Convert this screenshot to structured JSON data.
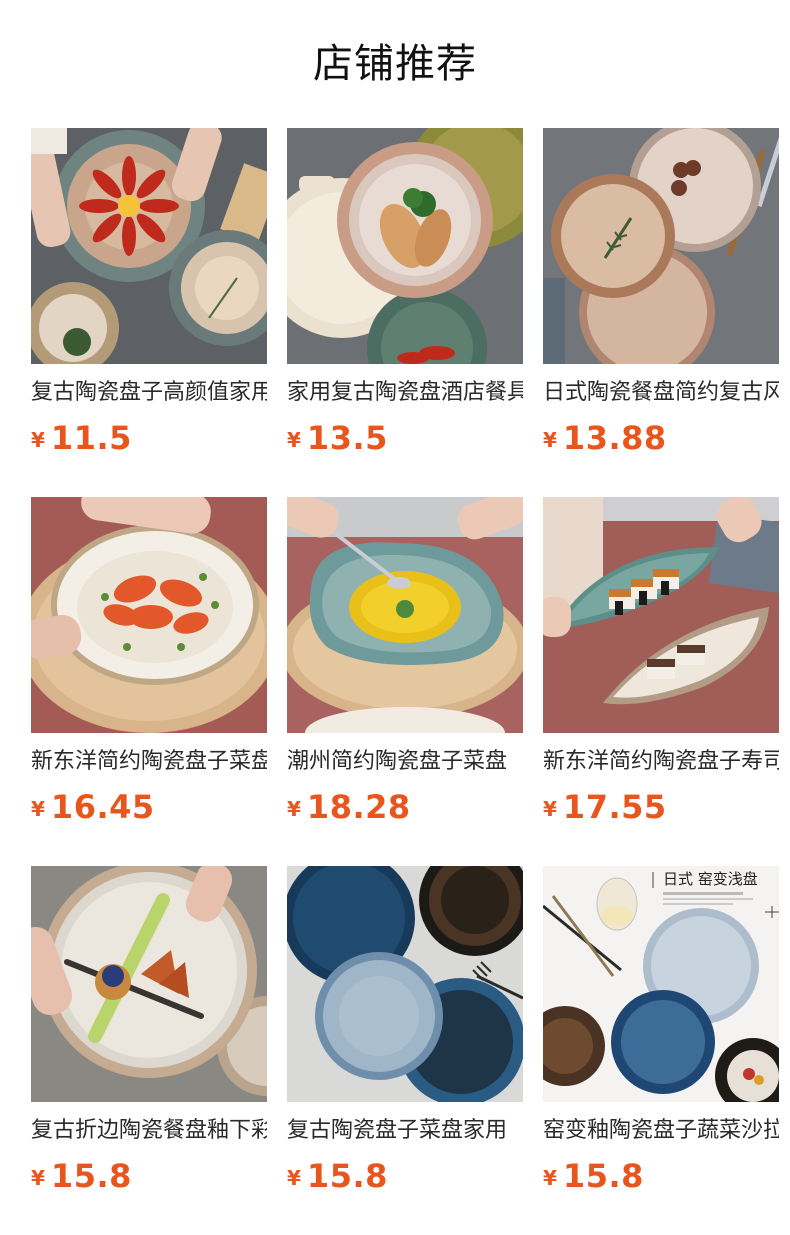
{
  "page": {
    "title": "店铺推荐"
  },
  "currency_symbol": "¥",
  "accent_color": "#e8561e",
  "products": [
    {
      "name": "复古陶瓷盘子高颜值家用",
      "price": "11.5"
    },
    {
      "name": "家用复古陶瓷盘酒店餐具",
      "price": "13.5"
    },
    {
      "name": "日式陶瓷餐盘简约复古风",
      "price": "13.88"
    },
    {
      "name": "新东洋简约陶瓷盘子菜盘",
      "price": "16.45"
    },
    {
      "name": "潮州简约陶瓷盘子菜盘",
      "price": "18.28"
    },
    {
      "name": "新东洋简约陶瓷盘子寿司",
      "price": "17.55"
    },
    {
      "name": "复古折边陶瓷餐盘釉下彩",
      "price": "15.8"
    },
    {
      "name": "复古陶瓷盘子菜盘家用",
      "price": "15.8"
    },
    {
      "name": "窑变釉陶瓷盘子蔬菜沙拉",
      "price": "15.8"
    }
  ],
  "photo_captions": {
    "item_9_title": "日式 窑变浅盘"
  }
}
